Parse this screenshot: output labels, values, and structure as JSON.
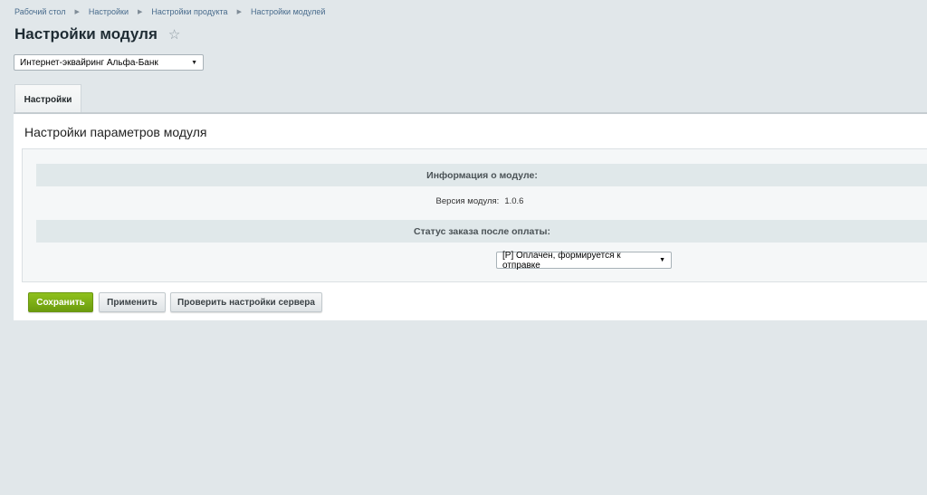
{
  "breadcrumb": [
    "Рабочий стол",
    "Настройки",
    "Настройки продукта",
    "Настройки модулей"
  ],
  "page": {
    "title": "Настройки модуля",
    "star_icon": "star-icon"
  },
  "module_select": {
    "value": "Интернет-эквайринг Альфа-Банк"
  },
  "tabs": [
    {
      "label": "Настройки"
    }
  ],
  "panel": {
    "heading": "Настройки параметров модуля",
    "info_header": "Информация о модуле:",
    "version_label": "Версия модуля:",
    "version_value": "1.0.6",
    "status_header": "Статус заказа после оплаты:",
    "status_value": "[P] Оплачен, формируется к отправке"
  },
  "buttons": {
    "save": "Сохранить",
    "apply": "Применить",
    "check": "Проверить настройки сервера"
  },
  "colors": {
    "background": "#e1e7ea",
    "accent_green": "#7aab14",
    "link": "#486b8c"
  }
}
